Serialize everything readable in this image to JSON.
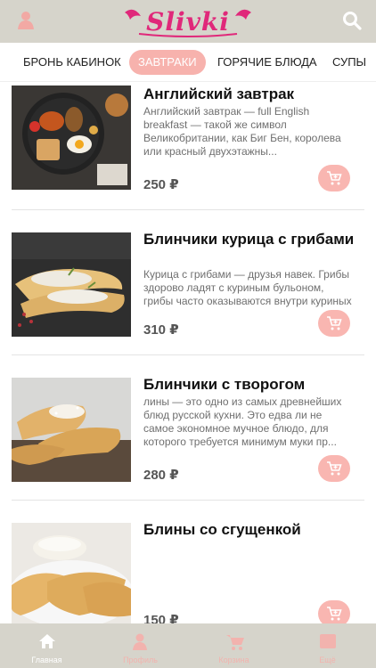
{
  "header": {
    "logo_text": "Slivki",
    "brand_color": "#e0287a",
    "left_icon": "user-icon",
    "right_icon": "search-icon"
  },
  "tabs": [
    {
      "label": "БРОНЬ КАБИНОК",
      "active": false
    },
    {
      "label": "ЗАВТРАКИ",
      "active": true
    },
    {
      "label": "ГОРЯЧИЕ БЛЮДА",
      "active": false
    },
    {
      "label": "СУПЫ",
      "active": false
    }
  ],
  "accent_color": "#f7b2ad",
  "products": [
    {
      "title": "Английский завтрак",
      "description": "Английский завтрак — full English breakfast — такой же символ Великобритании, как Биг Бен, королева или красный двухэтажны...",
      "price": "250 ₽",
      "image": "english-breakfast-photo"
    },
    {
      "title": "Блинчики курица с грибами",
      "description": "Курица с грибами — друзья навек. Грибы здорово ладят с куриным бульоном, грибы часто оказываются внутри куриных котлеток, встретились",
      "price": "310 ₽",
      "image": "chicken-mushroom-pancakes-photo"
    },
    {
      "title": "Блинчики с творогом",
      "description": "лины — это одно из самых древнейших блюд русской кухни. Это едва ли не самое экономное мучное блюдо, для которого требуется минимум муки пр...",
      "price": "280 ₽",
      "image": "cottage-cheese-pancakes-photo"
    },
    {
      "title": "Блины со сгущенкой",
      "description": "",
      "price": "150 ₽",
      "image": "condensed-milk-pancakes-photo"
    }
  ],
  "bottom_nav": [
    {
      "label": "Главная",
      "icon": "home-icon",
      "active": true
    },
    {
      "label": "Профиль",
      "icon": "profile-icon",
      "active": false
    },
    {
      "label": "Корзина",
      "icon": "cart-icon",
      "active": false
    },
    {
      "label": "Ещё",
      "icon": "menu-icon",
      "active": false
    }
  ]
}
